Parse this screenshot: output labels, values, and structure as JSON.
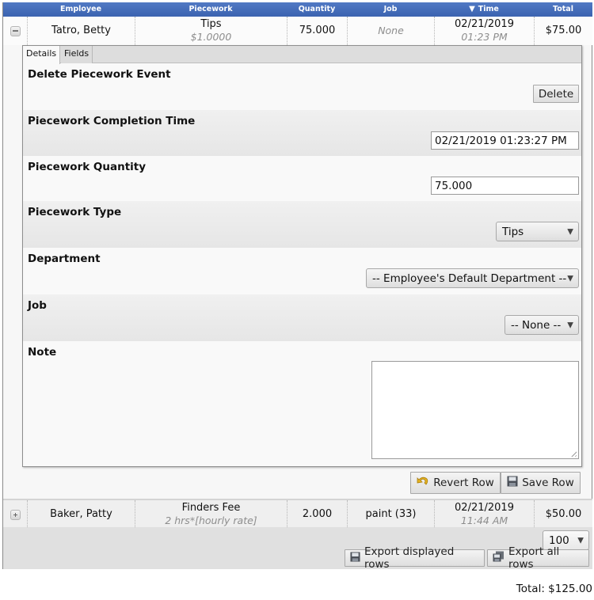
{
  "columns": [
    {
      "label": ""
    },
    {
      "label": "Employee"
    },
    {
      "label": "Piecework"
    },
    {
      "label": "Quantity"
    },
    {
      "label": "Job"
    },
    {
      "label": "Time",
      "sort_indicator": "▼"
    },
    {
      "label": "Total"
    }
  ],
  "rows": [
    {
      "expanded": true,
      "toggle_icon": "collapse-minus-icon",
      "employee": "Tatro, Betty",
      "piecework": "Tips",
      "piecework_sub": "$1.0000",
      "quantity": "75.000",
      "job": "None",
      "date": "02/21/2019",
      "time": "01:23 PM",
      "total": "$75.00"
    },
    {
      "expanded": false,
      "toggle_icon": "expand-plus-icon",
      "employee": "Baker, Patty",
      "piecework": "Finders Fee",
      "piecework_sub": "2 hrs*[hourly rate]",
      "quantity": "2.000",
      "job": "paint (33)",
      "date": "02/21/2019",
      "time": "11:44 AM",
      "total": "$50.00"
    }
  ],
  "detail": {
    "tabs": [
      {
        "label": "Details",
        "active": true
      },
      {
        "label": "Fields",
        "active": false
      }
    ],
    "sections": {
      "delete": {
        "label": "Delete Piecework Event",
        "button": "Delete"
      },
      "completion_time": {
        "label": "Piecework Completion Time",
        "value": "02/21/2019 01:23:27 PM"
      },
      "quantity": {
        "label": "Piecework Quantity",
        "value": "75.000"
      },
      "type": {
        "label": "Piecework Type",
        "selected": "Tips"
      },
      "department": {
        "label": "Department",
        "selected": "-- Employee's Default Department --"
      },
      "job": {
        "label": "Job",
        "selected": "-- None --"
      },
      "note": {
        "label": "Note",
        "value": ""
      }
    },
    "actions": {
      "revert": {
        "label": "Revert Row",
        "icon": "undo-arrow-icon"
      },
      "save": {
        "label": "Save Row",
        "icon": "floppy-disk-icon"
      }
    }
  },
  "footer": {
    "page_size": "100",
    "export_displayed": {
      "label": "Export displayed rows",
      "icon": "floppy-disk-icon"
    },
    "export_all": {
      "label": "Export all rows",
      "icon": "multi-floppy-icon"
    }
  },
  "grand_total": "Total: $125.00"
}
